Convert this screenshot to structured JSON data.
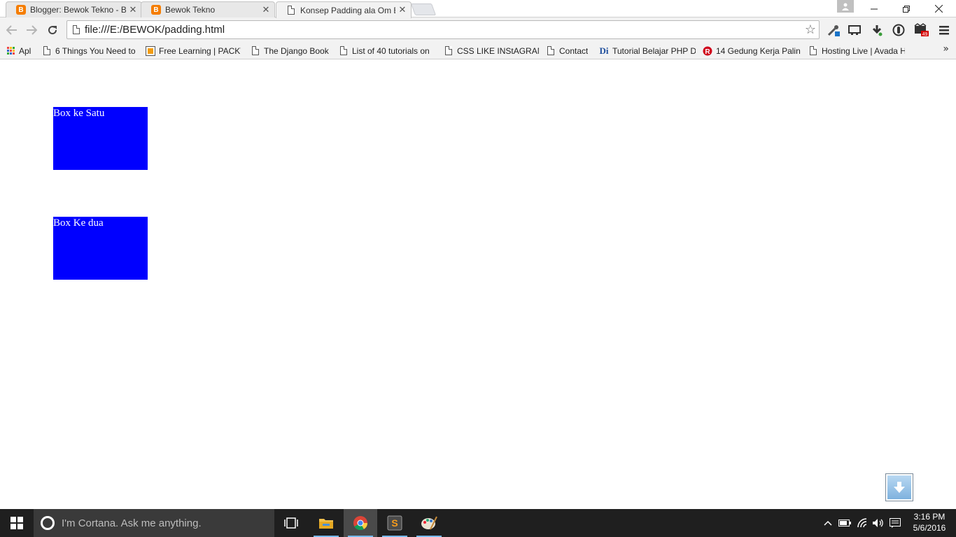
{
  "browser": {
    "tabs": [
      {
        "title": "Blogger: Bewok Tekno - B",
        "icon": "blogger-icon",
        "active": false
      },
      {
        "title": "Bewok Tekno",
        "icon": "blogger-icon",
        "active": false
      },
      {
        "title": "Konsep Padding ala Om B",
        "icon": "page-icon",
        "active": true
      }
    ],
    "address": "file:///E:/BEWOK/padding.html"
  },
  "bookmarks": [
    {
      "label": "Apl",
      "icon": "apps-grid-icon"
    },
    {
      "label": "6 Things You Need to",
      "icon": "page-icon"
    },
    {
      "label": "Free Learning | PACKT",
      "icon": "packt-icon"
    },
    {
      "label": "The Django Book",
      "icon": "page-icon"
    },
    {
      "label": "List of 40 tutorials on",
      "icon": "page-icon"
    },
    {
      "label": "CSS LIKE INStAGRAM",
      "icon": "page-icon"
    },
    {
      "label": "Contact",
      "icon": "page-icon"
    },
    {
      "label": "Tutorial Belajar PHP D",
      "icon": "duniailkom-icon"
    },
    {
      "label": "14 Gedung Kerja Palin",
      "icon": "red-badge-icon"
    },
    {
      "label": "Hosting Live | Avada H",
      "icon": "page-icon"
    }
  ],
  "page": {
    "boxes": [
      {
        "label": "Box ke Satu"
      },
      {
        "label": "Box Ke dua"
      }
    ]
  },
  "colors": {
    "box_background": "#0000ff",
    "box_text": "#ffffff"
  },
  "taskbar": {
    "cortana_placeholder": "I'm Cortana. Ask me anything.",
    "time": "3:16 PM",
    "date": "5/6/2016"
  }
}
